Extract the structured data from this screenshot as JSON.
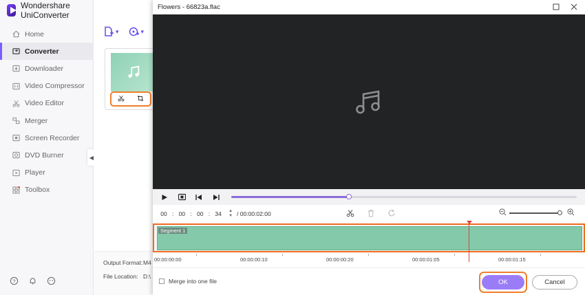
{
  "app": {
    "title": "Wondershare UniConverter"
  },
  "sidebar": {
    "items": [
      {
        "label": "Home",
        "icon": "home-icon"
      },
      {
        "label": "Converter",
        "icon": "converter-icon",
        "active": true
      },
      {
        "label": "Downloader",
        "icon": "download-icon"
      },
      {
        "label": "Video Compressor",
        "icon": "compress-icon"
      },
      {
        "label": "Video Editor",
        "icon": "scissors-icon"
      },
      {
        "label": "Merger",
        "icon": "merge-icon"
      },
      {
        "label": "Screen Recorder",
        "icon": "record-icon"
      },
      {
        "label": "DVD Burner",
        "icon": "disc-icon"
      },
      {
        "label": "Player",
        "icon": "play-icon"
      },
      {
        "label": "Toolbox",
        "icon": "grid-icon"
      }
    ]
  },
  "converter": {
    "output_format_label": "Output Format:",
    "output_format_value": "M4",
    "file_location_label": "File Location:",
    "file_location_value": "D:\\"
  },
  "dialog": {
    "title": "Flowers - 66823a.flac",
    "time": {
      "hh": "00",
      "mm": "00",
      "ss": "00",
      "ff": "34"
    },
    "duration": "/ 00:00:02:00",
    "progress_fraction": 0.34,
    "segment_label": "Segment 1",
    "ruler_labels": [
      "00:00:00:00",
      "00:00:00:10",
      "00:00:00:20",
      "00:00:01:05",
      "00:00:01:15"
    ],
    "merge_label": "Merge into one file",
    "ok_label": "OK",
    "cancel_label": "Cancel"
  },
  "colors": {
    "accent": "#9b7cf7",
    "highlight": "#ef7f2b",
    "segment": "#84c9aa",
    "playhead": "#d9413a"
  }
}
